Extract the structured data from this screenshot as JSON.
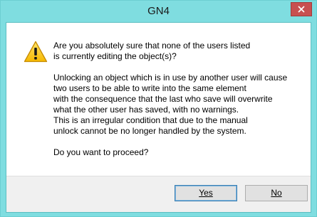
{
  "window": {
    "title": "GN4"
  },
  "dialog": {
    "icon": "warning-icon",
    "message_lines": [
      "Are you absolutely sure that none of the users listed",
      "is currently editing the object(s)?",
      "",
      "Unlocking an object which is in use by another user will cause",
      "two users to be able to write into the same element",
      "with the consequence that the last who save will overwrite",
      "what the other user has saved, with no warnings.",
      "This is an irregular condition that due to the manual",
      "unlock cannot be no longer handled by the system.",
      "",
      "Do you want to proceed?"
    ]
  },
  "buttons": {
    "yes_label": "Yes",
    "no_label": "No"
  },
  "colors": {
    "titlebar": "#7fdde0",
    "close": "#c75050",
    "footer": "#f0f0f0"
  }
}
